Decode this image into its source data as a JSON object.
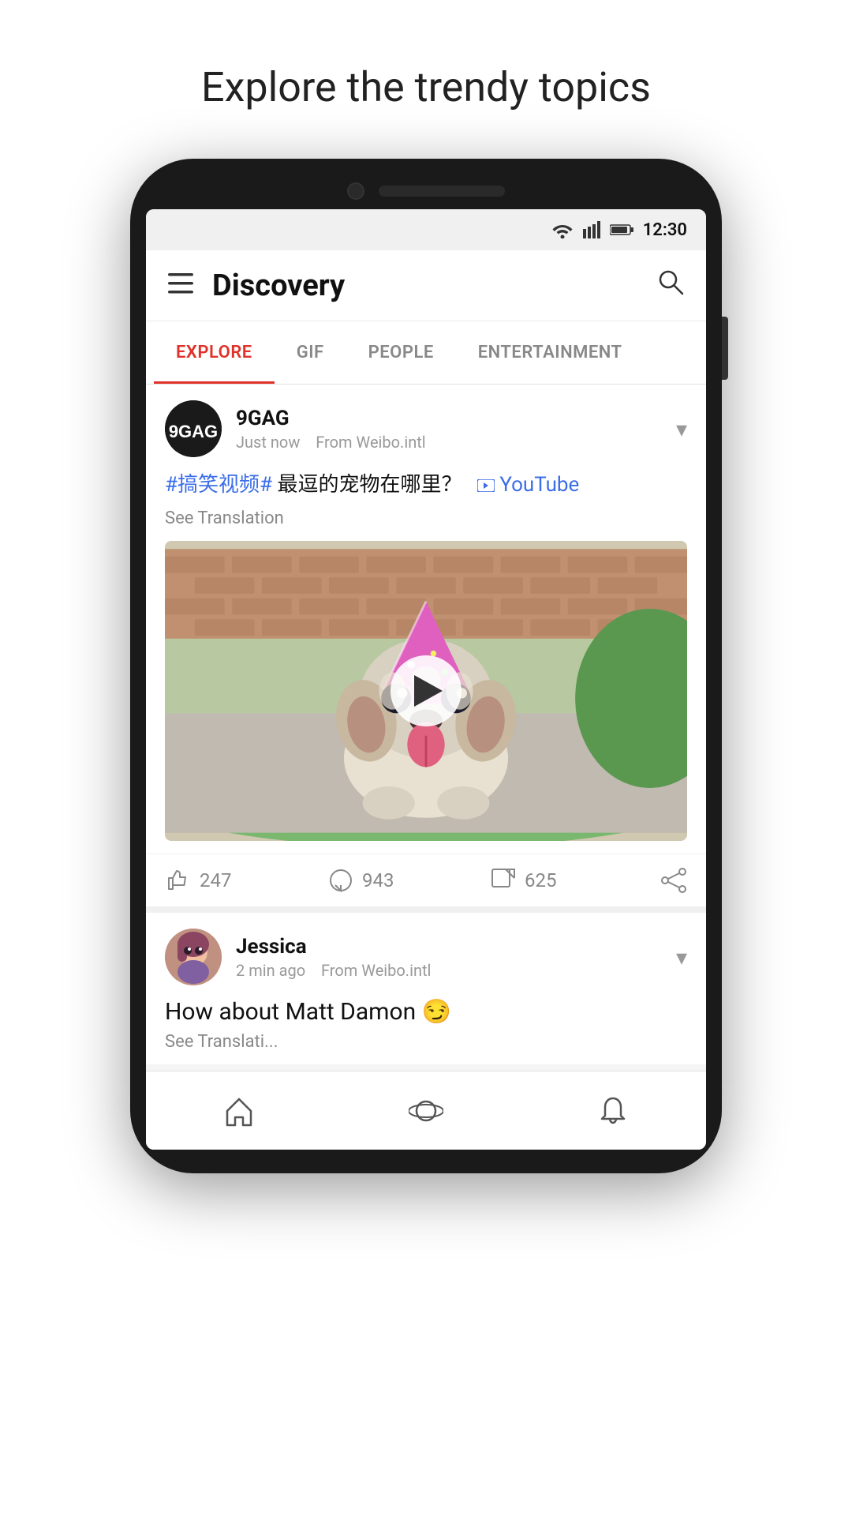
{
  "page": {
    "headline": "Explore the trendy topics"
  },
  "status_bar": {
    "time": "12:30",
    "icons": [
      "wifi",
      "signal",
      "battery"
    ]
  },
  "header": {
    "title": "Discovery",
    "menu_icon": "☰",
    "search_icon": "🔍"
  },
  "tabs": [
    {
      "id": "explore",
      "label": "EXPLORE",
      "active": true
    },
    {
      "id": "gif",
      "label": "GIF",
      "active": false
    },
    {
      "id": "people",
      "label": "PEOPLE",
      "active": false
    },
    {
      "id": "entertainment",
      "label": "ENTERTAINMENT",
      "active": false
    }
  ],
  "posts": [
    {
      "id": "post1",
      "author": "9GAG",
      "timestamp": "Just now",
      "source": "From Weibo.intl",
      "hashtag": "#搞笑视频#",
      "text_chinese": "最逗的宠物在哪里？",
      "youtube_label": "YouTube",
      "see_translation": "See Translation",
      "likes": "247",
      "comments": "943",
      "shares": "625"
    },
    {
      "id": "post2",
      "author": "Jessica",
      "timestamp": "2 min ago",
      "source": "From Weibo.intl",
      "text": "How about Matt Damon",
      "emoji": "😏",
      "see_translation": "See Translati..."
    }
  ],
  "bottom_nav": {
    "items": [
      {
        "id": "home",
        "icon": "home"
      },
      {
        "id": "discover",
        "icon": "discover"
      },
      {
        "id": "notifications",
        "icon": "bell"
      }
    ]
  }
}
